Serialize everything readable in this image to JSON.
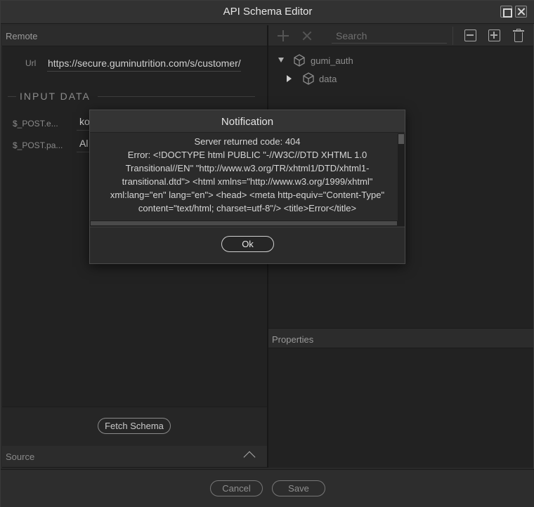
{
  "window": {
    "title": "API Schema Editor"
  },
  "remote": {
    "header": "Remote",
    "url_label": "Url",
    "url_value": "https://secure.guminutrition.com/s/customer/login",
    "input_data_label": "INPUT DATA",
    "params": [
      {
        "label": "$_POST.e...",
        "value": "ko"
      },
      {
        "label": "$_POST.pa...",
        "value": "Al"
      }
    ],
    "fetch_button": "Fetch Schema",
    "source_header": "Source"
  },
  "tree": {
    "search_placeholder": "Search",
    "nodes": [
      {
        "label": "gumi_auth",
        "expanded": true
      },
      {
        "label": "data",
        "expanded": false
      }
    ]
  },
  "properties": {
    "header": "Properties"
  },
  "footer": {
    "cancel": "Cancel",
    "save": "Save"
  },
  "modal": {
    "title": "Notification",
    "line1": "Server returned code: 404",
    "line2": "Error: <!DOCTYPE html PUBLIC \"-//W3C//DTD XHTML 1.0 Transitional//EN\" \"http://www.w3.org/TR/xhtml1/DTD/xhtml1-transitional.dtd\"> <html xmlns=\"http://www.w3.org/1999/xhtml\" xml:lang=\"en\" lang=\"en\"> <head> <meta http-equiv=\"Content-Type\" content=\"text/html; charset=utf-8\"/> <title>Error</title>",
    "ok": "Ok"
  },
  "colors": {
    "background": "#222222",
    "panel_header": "#2c2c2c",
    "text": "#cfcfcf"
  }
}
